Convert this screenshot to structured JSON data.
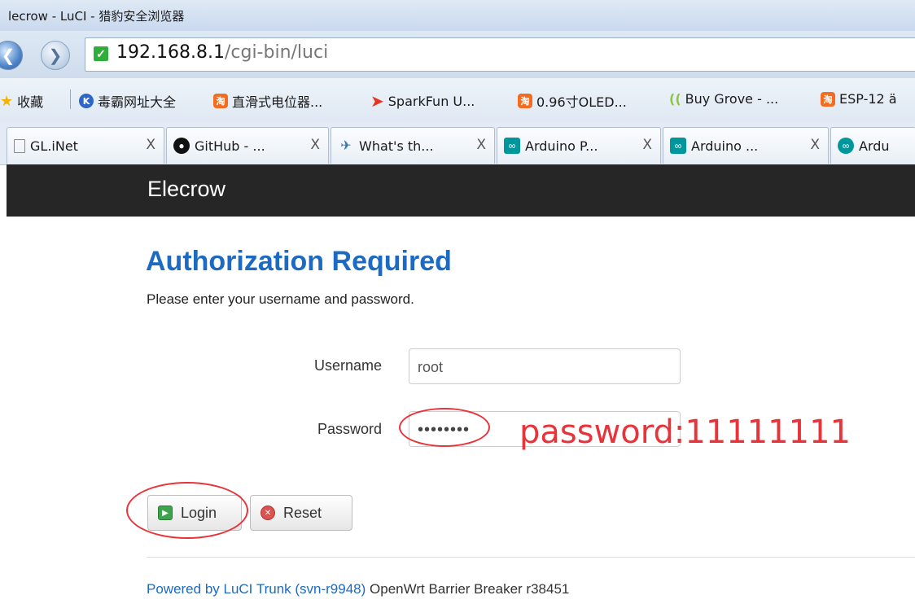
{
  "browser": {
    "window_title": "lecrow - LuCI - 猎豹安全浏览器",
    "url_host": "192.168.8.1",
    "url_path": "/cgi-bin/luci",
    "bookmarks": [
      {
        "label": "收藏",
        "icon": "star-icon"
      },
      {
        "label": "毒霸网址大全",
        "icon": "duba-icon"
      },
      {
        "label": "直滑式电位器...",
        "icon": "taobao-icon"
      },
      {
        "label": "SparkFun U...",
        "icon": "sparkfun-icon"
      },
      {
        "label": "0.96寸OLED...",
        "icon": "taobao-icon"
      },
      {
        "label": "Buy Grove - ...",
        "icon": "seeed-icon"
      },
      {
        "label": "ESP-12 ä",
        "icon": "taobao-icon"
      }
    ],
    "tabs": [
      {
        "label": "GL.iNet",
        "icon": "page-icon",
        "close": "X"
      },
      {
        "label": "GitHub - ...",
        "icon": "github-icon",
        "close": "X"
      },
      {
        "label": "What's th...",
        "icon": "forum-icon",
        "close": "X"
      },
      {
        "label": "Arduino P...",
        "icon": "arduino-icon",
        "close": "X"
      },
      {
        "label": "Arduino ...",
        "icon": "arduino-icon",
        "close": "X"
      },
      {
        "label": "Ardu",
        "icon": "arduino-icon",
        "close": ""
      }
    ]
  },
  "page": {
    "brand": "Elecrow",
    "heading": "Authorization Required",
    "subheading": "Please enter your username and password.",
    "username_label": "Username",
    "username_value": "root",
    "password_label": "Password",
    "password_value": "••••••••",
    "login_label": "Login",
    "reset_label": "Reset",
    "footer_link": "Powered by LuCI Trunk (svn-r9948)",
    "footer_text": " OpenWrt Barrier Breaker r38451"
  },
  "annotation": {
    "text": "password:11111111",
    "color": "#e8333a"
  },
  "colors": {
    "heading": "#1c6ac1",
    "header_bar": "#262626"
  }
}
